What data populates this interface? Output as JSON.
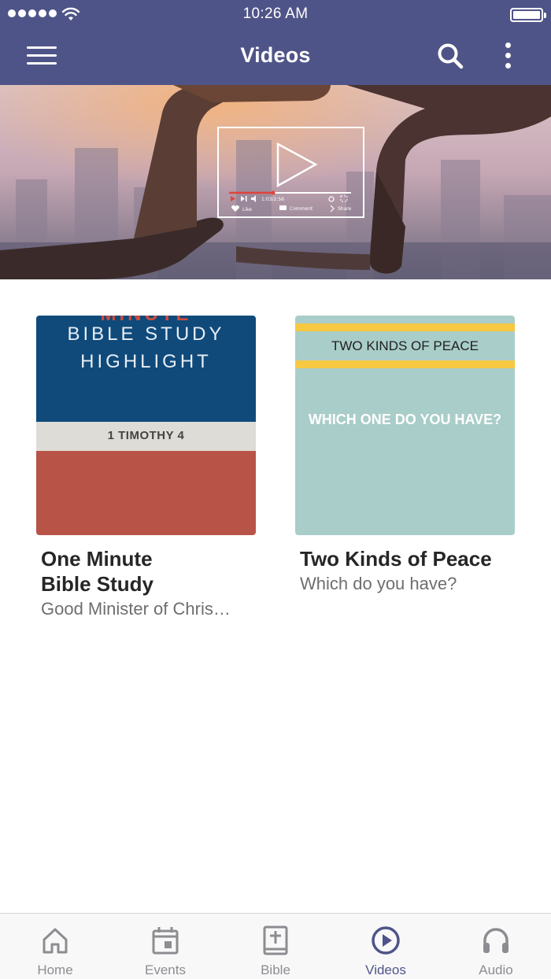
{
  "status_bar": {
    "time": "10:26 AM"
  },
  "header": {
    "title": "Videos",
    "background": "#4f5488",
    "icons": [
      "menu-icon",
      "search-icon",
      "more-vertical-icon"
    ]
  },
  "hero": {
    "image": "hands-framing-video-player-icon"
  },
  "videos": [
    {
      "title_line1": "One Minute",
      "title_line2": "Bible Study",
      "subtitle": "Good Minister of Chris…",
      "thumb": {
        "line1": "BIBLE STUDY",
        "line2": "HIGHLIGHT",
        "band": "1 TIMOTHY 4",
        "colors": {
          "top": "#0f4a7b",
          "band": "#dedcd7",
          "bottom": "#b85447"
        }
      }
    },
    {
      "title_line1": "Two Kinds of Peace",
      "subtitle": "Which do you have?",
      "thumb": {
        "heading": "TWO KINDS OF PEACE",
        "question": "WHICH ONE DO YOU HAVE?",
        "colors": {
          "background": "#a9cdc9",
          "stripe": "#f7c842"
        }
      }
    }
  ],
  "tabs": [
    {
      "label": "Home",
      "icon": "home-icon",
      "active": false
    },
    {
      "label": "Events",
      "icon": "calendar-icon",
      "active": false
    },
    {
      "label": "Bible",
      "icon": "bible-icon",
      "active": false
    },
    {
      "label": "Videos",
      "icon": "play-circle-icon",
      "active": true
    },
    {
      "label": "Audio",
      "icon": "headphones-icon",
      "active": false
    }
  ],
  "colors": {
    "accent": "#4f5488",
    "tab_inactive": "#8d8d91"
  }
}
